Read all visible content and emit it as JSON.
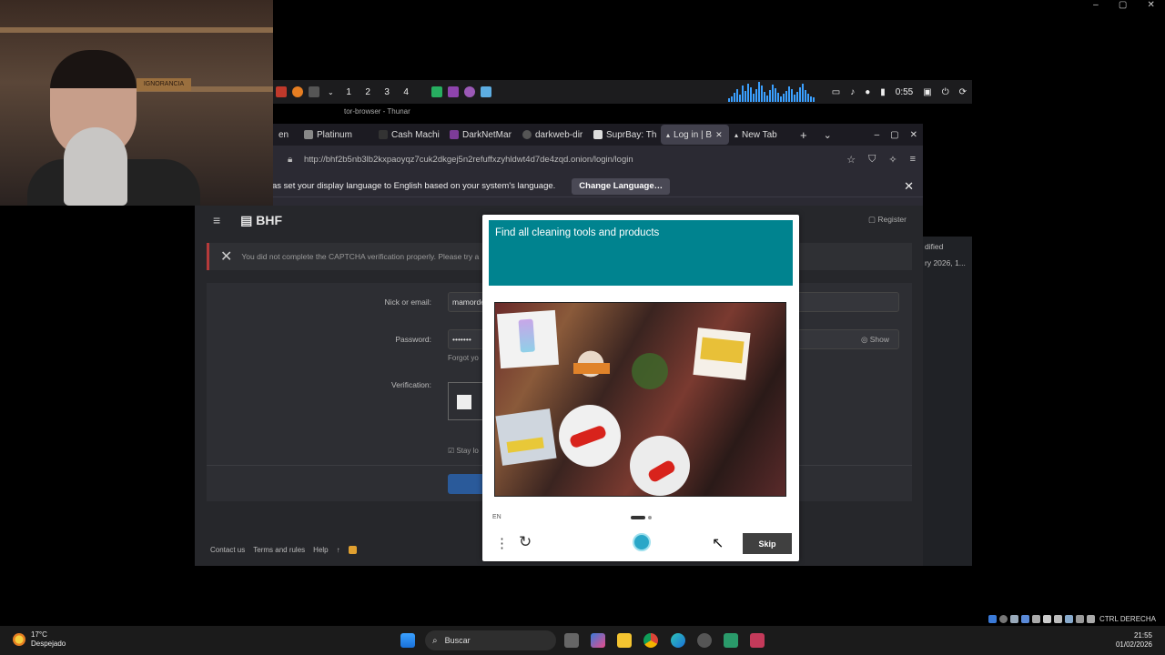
{
  "outer_window": {
    "minimize": "–",
    "maximize": "▢",
    "close": "✕"
  },
  "webcam": {
    "sign_text": "IGNORANCIA"
  },
  "top_panel": {
    "workspaces": [
      "1",
      "2",
      "3",
      "4"
    ],
    "time": "0:55"
  },
  "thunar_title": "tor-browser - Thunar",
  "browser": {
    "tabs": [
      {
        "label": "en",
        "icon_color": "#c0392b"
      },
      {
        "label": "Platinum",
        "icon_color": "#888888"
      },
      {
        "label": "Cash Machi",
        "icon_color": "#333333"
      },
      {
        "label": "DarkNetMar",
        "icon_color": "#7d3c98"
      },
      {
        "label": "darkweb-dir",
        "icon_color": "#555555"
      },
      {
        "label": "SuprBay: Th",
        "icon_color": "#dddddd"
      },
      {
        "label": "Log in | B",
        "icon_color": "#666666",
        "active": true
      },
      {
        "label": "New Tab",
        "icon_color": "#666666"
      }
    ],
    "new_tab": "+",
    "tab_list": "⌄",
    "win_min": "–",
    "win_max": "▢",
    "win_close": "✕",
    "url": "http://bhf2b5nb3lb2kxpaoyqz7cuk2dkgej5n2refuffxzyhldwt4d7de4zqd.onion/login/login",
    "notification": {
      "message": "as set your display language to English based on your system's language.",
      "button": "Change Language…",
      "close": "✕"
    }
  },
  "site": {
    "menu_icon": "≡",
    "logo": "BHF",
    "register": "Register",
    "alert": "You did not complete the CAPTCHA verification properly. Please try a",
    "alert_close": "✕",
    "form": {
      "nick_label": "Nick or email:",
      "nick_value": "mamorde",
      "password_label": "Password:",
      "password_value": "•••••••",
      "forgot": "Forgot yo",
      "show": "Show",
      "verification_label": "Verification:",
      "stay": "Stay lo"
    },
    "footer": {
      "contact": "Contact us",
      "terms": "Terms and rules",
      "help": "Help",
      "up": "↑"
    }
  },
  "right_strip": {
    "line1": "dified",
    "line2": "ry 2026, 1..."
  },
  "captcha": {
    "prompt": "Find all cleaning tools and products",
    "lang": "EN",
    "skip": "Skip",
    "menu_icon": "⋮",
    "refresh_icon": "↻"
  },
  "taskbar": {
    "temp": "17°C",
    "weather": "Despejado",
    "search_placeholder": "Buscar",
    "time": "21:55",
    "date": "01/02/2026",
    "tray_text": "CTRL DERECHA"
  }
}
